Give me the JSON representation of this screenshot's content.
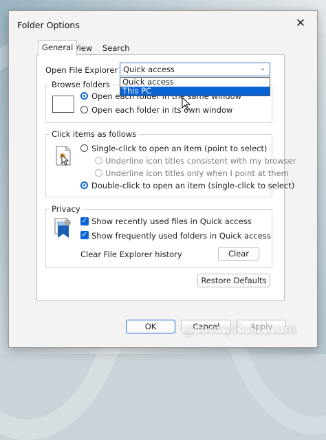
{
  "dialog": {
    "title": "Folder Options",
    "close_glyph": "✕"
  },
  "tabs": [
    {
      "label": "General",
      "active": true
    },
    {
      "label": "View",
      "active": false
    },
    {
      "label": "Search",
      "active": false
    }
  ],
  "open_to": {
    "label": "Open File Explorer to:",
    "selected_value": "Quick access",
    "options": [
      "Quick access",
      "This PC"
    ],
    "highlighted_option": "This PC"
  },
  "browse_folders": {
    "label": "Browse folders",
    "option_same_window": "Open each folder in the same window",
    "option_same_window_visible": "Open each folder in the same window",
    "option_own_window": "Open each folder in its own window"
  },
  "click_items": {
    "label": "Click items as follows",
    "single_click": "Single-click to open an item (point to select)",
    "underline_consistent": "Underline icon titles consistent with my browser",
    "underline_point": "Underline icon titles only when I point at them",
    "double_click": "Double-click to open an item (single-click to select)",
    "selected": "double_click"
  },
  "privacy": {
    "label": "Privacy",
    "recent_files": "Show recently used files in Quick access",
    "frequent_folders": "Show frequently used folders in Quick access",
    "clear_history_label": "Clear File Explorer history",
    "clear_button": "Clear"
  },
  "buttons": {
    "restore_defaults": "Restore Defaults",
    "ok": "OK",
    "cancel": "Cancel",
    "apply": "Apply"
  },
  "watermark": "groovyPost.com",
  "colors": {
    "accent": "#0a64d6"
  }
}
